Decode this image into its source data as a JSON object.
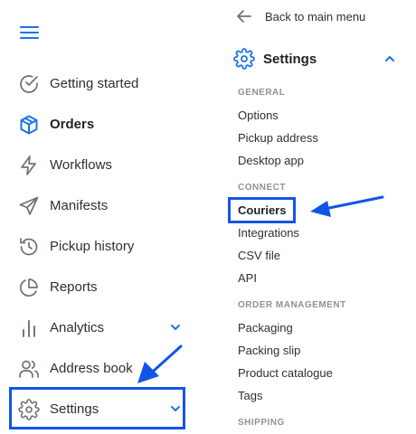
{
  "colors": {
    "accent": "#1a73e8",
    "annotation": "#1155e8",
    "text": "#2b2f36",
    "muted": "#8d929b"
  },
  "sidebar": {
    "menu_icon": "hamburger-icon",
    "items": [
      {
        "label": "Getting started",
        "icon": "check-circle-icon"
      },
      {
        "label": "Orders",
        "icon": "package-icon",
        "active": true
      },
      {
        "label": "Workflows",
        "icon": "lightning-icon"
      },
      {
        "label": "Manifests",
        "icon": "paper-plane-icon"
      },
      {
        "label": "Pickup history",
        "icon": "history-icon"
      },
      {
        "label": "Reports",
        "icon": "pie-chart-icon"
      },
      {
        "label": "Analytics",
        "icon": "bar-chart-icon",
        "expandable": true
      },
      {
        "label": "Address book",
        "icon": "users-icon"
      },
      {
        "label": "Settings",
        "icon": "gear-icon",
        "expandable": true,
        "highlighted": true
      }
    ]
  },
  "panel": {
    "back_label": "Back to main menu",
    "section_title": "Settings",
    "groups": [
      {
        "title": "GENERAL",
        "items": [
          "Options",
          "Pickup address",
          "Desktop app"
        ]
      },
      {
        "title": "CONNECT",
        "items": [
          "Couriers",
          "Integrations",
          "CSV file",
          "API"
        ]
      },
      {
        "title": "ORDER MANAGEMENT",
        "items": [
          "Packaging",
          "Packing slip",
          "Product catalogue",
          "Tags"
        ]
      },
      {
        "title": "SHIPPING",
        "items": []
      }
    ]
  }
}
